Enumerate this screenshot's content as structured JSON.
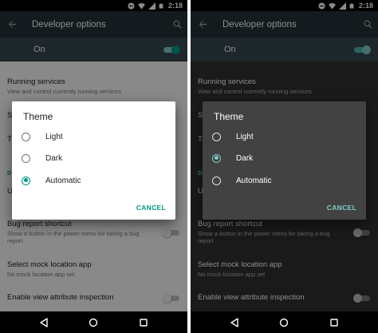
{
  "colors": {
    "accent_light_theme": "#009688",
    "accent_dark_theme": "#80cbc4",
    "toolbar": "#263238",
    "master_bar": "#37474f",
    "light_background": "#fafafa",
    "dark_background": "#303030",
    "dark_dialog": "#424242"
  },
  "status_bar": {
    "time": "2:18",
    "icons": [
      "minus-circle-icon",
      "wifi-icon",
      "signal-icon",
      "battery-icon"
    ]
  },
  "toolbar": {
    "title": "Developer options",
    "back_icon": "arrow-back-icon",
    "search_icon": "search-icon"
  },
  "master_switch": {
    "label": "On",
    "checked": true
  },
  "settings": {
    "running_services": {
      "title": "Running services",
      "summary": "View and control currently running services"
    },
    "frag_s": "S",
    "frag_t": "T",
    "frag_d": "D",
    "frag_u": "U",
    "bug_report": {
      "title": "Bug report shortcut",
      "summary": "Show a button in the power menu for taking a bug report",
      "checked": false
    },
    "mock_location": {
      "title": "Select mock location app",
      "summary": "No mock location app set"
    },
    "view_attribute": {
      "title": "Enable view attribute inspection",
      "checked": false
    }
  },
  "theme_dialog": {
    "title": "Theme",
    "options": [
      "Light",
      "Dark",
      "Automatic"
    ],
    "cancel_label": "CANCEL"
  },
  "screens": [
    {
      "theme": "light",
      "selected_option": "Automatic"
    },
    {
      "theme": "dark",
      "selected_option": "Dark"
    }
  ],
  "nav_bar": {
    "icons": [
      "back-triangle-icon",
      "home-circle-icon",
      "recents-square-icon"
    ]
  }
}
